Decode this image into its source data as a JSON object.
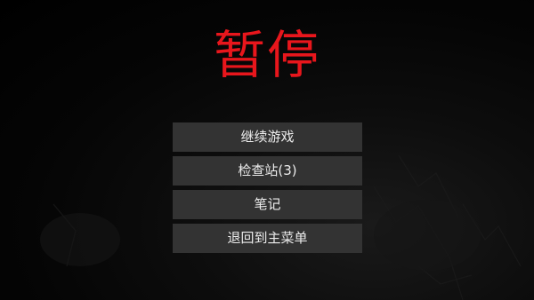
{
  "pause_menu": {
    "title": "暂停",
    "items": [
      {
        "label": "继续游戏"
      },
      {
        "label": "检查站(3)"
      },
      {
        "label": "笔记"
      },
      {
        "label": "退回到主菜单"
      }
    ]
  },
  "colors": {
    "title": "#e8161c",
    "button_bg": "#333333",
    "button_text": "#ececec",
    "background": "#000000"
  }
}
